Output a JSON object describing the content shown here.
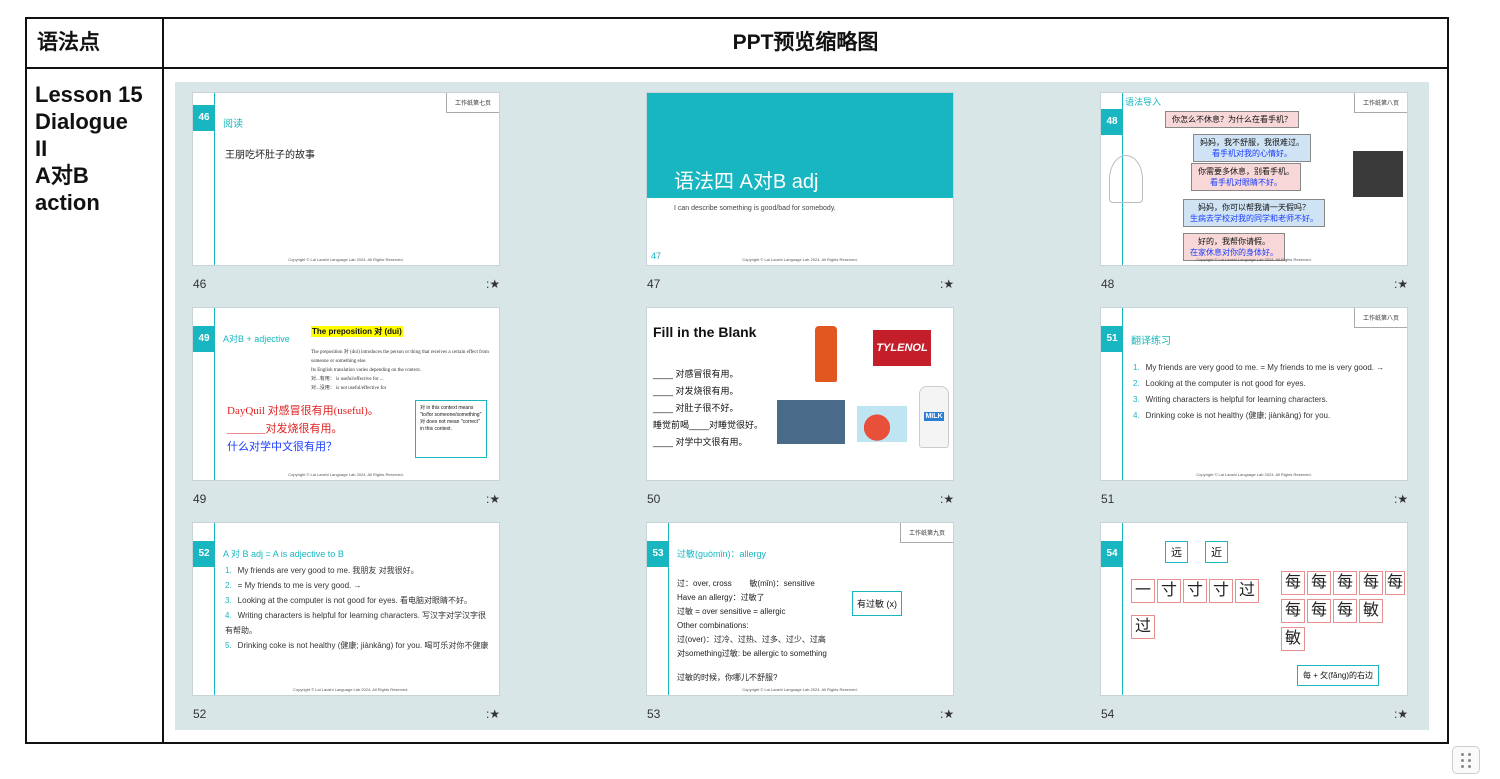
{
  "table": {
    "header_left": "语法点",
    "header_right": "PPT预览缩略图",
    "left_cell_lines": [
      "Lesson 15",
      "Dialogue",
      "II",
      "A对B",
      "action"
    ]
  },
  "slides": [
    {
      "num": "46",
      "label": "46",
      "title": "阅读",
      "tag": "工作纸第七页",
      "lines": [
        "王朋吃坏肚子的故事"
      ],
      "footer": "Copyright © Lai Laoshi Language Lab 2024. All Rights Reserved."
    },
    {
      "num": "47",
      "label": "47",
      "title": "语法四 A对B adj",
      "subtitle": "I can describe something is good/bad for somebody.",
      "footer": "Copyright © Lai Laoshi Language Lab 2024. All Rights Reserved."
    },
    {
      "num": "48",
      "label": "48",
      "title": "语法导入",
      "tag": "工作纸第八页",
      "footer": "Copyright © Lai Laoshi Language Lab 2024. All Rights Reserved.",
      "bubbles": [
        {
          "l1": "你怎么不休息？为什么在看手机？",
          "l2": ""
        },
        {
          "l1": "妈妈，我不舒服，我很难过。",
          "l2": "看手机对我的心情好。"
        },
        {
          "l1": "你需要多休息，别看手机。",
          "l2": "看手机对眼睛不好。"
        },
        {
          "l1": "妈妈，你可以帮我请一天假吗？",
          "l2": "生病去学校对我的同学和老师不好。"
        },
        {
          "l1": "好的，我帮你请假。",
          "l2": "在家休息对你的身体好。"
        }
      ]
    },
    {
      "num": "49",
      "label": "49",
      "title": "A对B + adjective",
      "heading": "The preposition 对 (duì)",
      "footer": "Copyright © Lai Laoshi Language Lab 2024. All Rights Reserved.",
      "bullets": [
        "The preposition 对 (duì) introduces the person or thing that receives a certain effect from someone or something else.",
        "Its English translation varies depending on the context.",
        "对...有用： is useful/effective for ...",
        "对...没用： is not useful/effective for"
      ],
      "examples": [
        "DayQuil 对感冒很有用(useful)。",
        "_______对发烧很有用。",
        "什么对学中文很有用？"
      ],
      "note": "对 in this context means \"to/for someone/something\" 对 does not mean \"correct\" in this context."
    },
    {
      "num": "50",
      "label": "50",
      "title": "Fill in the Blank",
      "lines": [
        "____ 对感冒很有用。",
        "____ 对发烧很有用。",
        "____ 对肚子很不好。",
        "睡觉前喝____对睡觉很好。",
        "____ 对学中文很有用。"
      ],
      "brand": "TYLENOL",
      "milk": "MILK"
    },
    {
      "num": "51",
      "label": "51",
      "title": "翻译练习",
      "tag": "工作纸第八页",
      "footer": "Copyright © Lai Laoshi Language Lab 2024. All Rights Reserved.",
      "items": [
        "My friends are very good to me. = My friends to me is very good. →",
        "Looking at the computer is not good for eyes.",
        "Writing characters is helpful for learning characters.",
        "Drinking coke is not healthy (健康; jiànkāng) for you."
      ]
    },
    {
      "num": "52",
      "label": "52",
      "title": "A 对 B adj = A is adjective to B",
      "footer": "Copyright © Lai Laoshi Language Lab 2024. All Rights Reserved.",
      "items": [
        "My friends are very good to me. 我朋友 对我很好。",
        "= My friends to me is very good. →",
        "Looking at the computer is not good for eyes. 看电脑对眼睛不好。",
        "Writing characters is helpful for learning characters. 写汉字对学汉字很有帮助。",
        "Drinking coke is not healthy (健康; jiànkāng) for you. 喝可乐对你不健康"
      ]
    },
    {
      "num": "53",
      "label": "53",
      "title": "过敏(guòmǐn)：allergy",
      "tag": "工作纸第九页",
      "footer": "Copyright © Lai Laoshi Language Lab 2024. All Rights Reserved.",
      "lines": [
        "过：over, cross        敏(mǐn)：sensitive",
        "Have an allergy：过敏了",
        "过敏 = over sensitive = allergic",
        "Other combinations:",
        "过(over)：过冷、过热、过多、过少、过高",
        "对something过敏: be allergic to something",
        "",
        "过敏的时候，你哪儿不舒服?"
      ],
      "box": "有过敏 (x)"
    },
    {
      "num": "54",
      "label": "54",
      "far": "远",
      "near": "近",
      "note": "每 + 攵(fǎng)的右边",
      "chars_guo": [
        "一",
        "寸",
        "寸",
        "寸",
        "过"
      ],
      "chars_min": [
        "每",
        "每",
        "每",
        "每",
        "每",
        "每",
        "每",
        "每",
        "敏"
      ]
    }
  ],
  "star_icon_label": ":★"
}
